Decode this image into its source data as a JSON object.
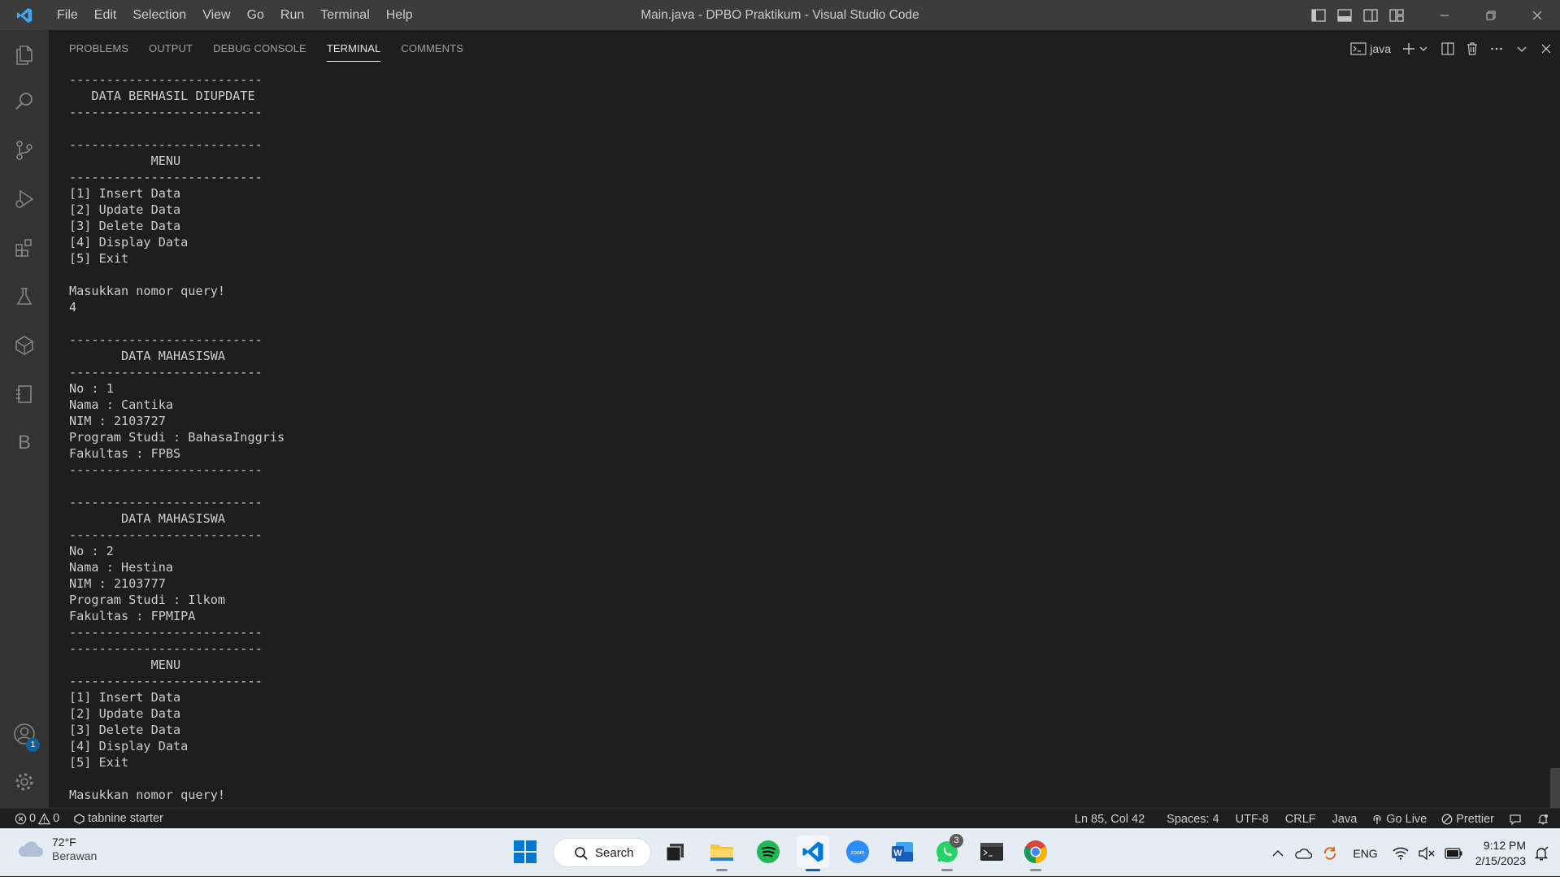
{
  "titlebar": {
    "title": "Main.java - DPBO Praktikum - Visual Studio Code",
    "menu": [
      "File",
      "Edit",
      "Selection",
      "View",
      "Go",
      "Run",
      "Terminal",
      "Help"
    ]
  },
  "activity_bar": {
    "account_badge": "1",
    "items": [
      "explorer-icon",
      "search-icon",
      "source-control-icon",
      "run-debug-icon",
      "extensions-icon",
      "testing-icon",
      "remote-explorer-icon",
      "notebook-icon",
      "b-extension-icon"
    ]
  },
  "panel": {
    "tabs": [
      "PROBLEMS",
      "OUTPUT",
      "DEBUG CONSOLE",
      "TERMINAL",
      "COMMENTS"
    ],
    "active_tab": "TERMINAL",
    "terminal_name": "java"
  },
  "terminal": {
    "lines": [
      "--------------------------",
      "   DATA BERHASIL DIUPDATE",
      "--------------------------",
      "",
      "--------------------------",
      "           MENU",
      "--------------------------",
      "[1] Insert Data",
      "[2] Update Data",
      "[3] Delete Data",
      "[4] Display Data",
      "[5] Exit",
      "",
      "Masukkan nomor query!",
      "4",
      "",
      "--------------------------",
      "       DATA MAHASISWA",
      "--------------------------",
      "No : 1",
      "Nama : Cantika",
      "NIM : 2103727",
      "Program Studi : BahasaInggris",
      "Fakultas : FPBS",
      "--------------------------",
      "",
      "--------------------------",
      "       DATA MAHASISWA",
      "--------------------------",
      "No : 2",
      "Nama : Hestina",
      "NIM : 2103777",
      "Program Studi : Ilkom",
      "Fakultas : FPMIPA",
      "--------------------------",
      "--------------------------",
      "           MENU",
      "--------------------------",
      "[1] Insert Data",
      "[2] Update Data",
      "[3] Delete Data",
      "[4] Display Data",
      "[5] Exit",
      "",
      "Masukkan nomor query!"
    ]
  },
  "statusbar": {
    "errors": "0",
    "warnings": "0",
    "tabnine": "tabnine starter",
    "position": "Ln 85, Col 42",
    "spaces": "Spaces: 4",
    "encoding": "UTF-8",
    "eol": "CRLF",
    "language": "Java",
    "go_live": "Go Live",
    "prettier": "Prettier"
  },
  "taskbar": {
    "weather_temp": "72°F",
    "weather_desc": "Berawan",
    "search_label": "Search",
    "whatsapp_badge": "3",
    "language": "ENG",
    "time": "9:12 PM",
    "date": "2/15/2023",
    "colors": {
      "windows_blue": "#0078d4",
      "spotify_green": "#1db954",
      "vscode_blue": "#0078d7",
      "zoom_blue": "#2d8cff",
      "word_blue": "#185abd",
      "whatsapp_green": "#25d366"
    }
  }
}
